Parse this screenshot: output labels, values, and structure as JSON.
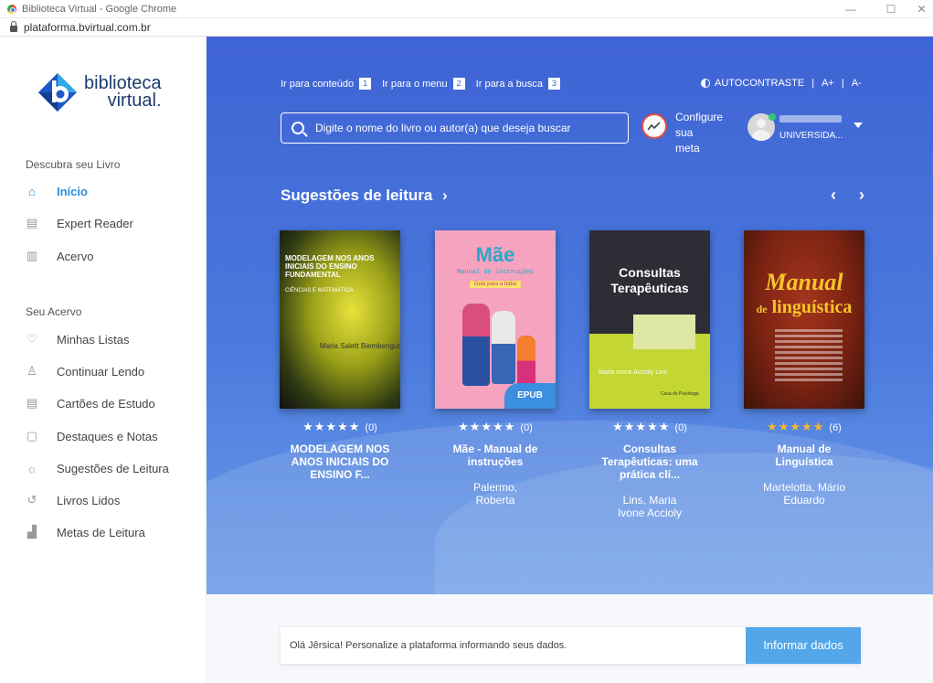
{
  "browser": {
    "window_title": "Biblioteca Virtual - Google Chrome",
    "url": "plataforma.bvirtual.com.br",
    "minimize": "—",
    "maximize": "☐",
    "close": "✕"
  },
  "brand": {
    "line1": "biblioteca",
    "line2": "virtual."
  },
  "sidebar": {
    "section1": "Descubra seu Livro",
    "nav1": [
      {
        "label": "Início",
        "icon": "home-icon",
        "glyph": "⌂"
      },
      {
        "label": "Expert Reader",
        "icon": "document-list-icon",
        "glyph": "▤"
      },
      {
        "label": "Acervo",
        "icon": "bookshelf-icon",
        "glyph": "▥"
      }
    ],
    "section2": "Seu Acervo",
    "nav2": [
      {
        "label": "Minhas Listas",
        "icon": "heart-icon",
        "glyph": "♡"
      },
      {
        "label": "Continuar Lendo",
        "icon": "reading-person-icon",
        "glyph": "♙"
      },
      {
        "label": "Cartões de Estudo",
        "icon": "flashcard-icon",
        "glyph": "▤"
      },
      {
        "label": "Destaques e Notas",
        "icon": "note-icon",
        "glyph": "▢"
      },
      {
        "label": "Sugestões de Leitura",
        "icon": "lightbulb-icon",
        "glyph": "☼"
      },
      {
        "label": "Livros Lidos",
        "icon": "history-icon",
        "glyph": "↺"
      },
      {
        "label": "Metas de Leitura",
        "icon": "chart-icon",
        "glyph": "▟"
      }
    ]
  },
  "topnav": {
    "skip_content": "Ir para conteúdo",
    "num1": "1",
    "skip_menu": "Ir para o menu",
    "num2": "2",
    "skip_search": "Ir para a busca",
    "num3": "3",
    "contrast": "AUTOCONTRASTE",
    "sep": "|",
    "font_up": "A+",
    "font_down": "A-"
  },
  "search": {
    "placeholder": "Digite o nome do livro ou autor(a) que deseja buscar"
  },
  "goal": {
    "line1": "Configure sua",
    "line2": "meta"
  },
  "user": {
    "org": "UNIVERSIDA..."
  },
  "suggestions": {
    "title": "Sugestões de leitura",
    "title_arrow": "›",
    "prev": "‹",
    "next": "›"
  },
  "books": [
    {
      "cover_title": "MODELAGEM NOS ANOS INICIAIS DO ENSINO FUNDAMENTAL",
      "cover_sub": "CIÊNCIAS E MATEMÁTICA",
      "cover_author": "Maria Salett Biembengut",
      "stars": "★★★★★",
      "count": "(0)",
      "title": "MODELAGEM NOS ANOS INICIAIS DO ENSINO F...",
      "author": ""
    },
    {
      "cover_title": "Mãe",
      "cover_sub": "Manual de instruções",
      "cover_tag": "Guia para a baba",
      "badge": "EPUB",
      "stars": "★★★★★",
      "count": "(0)",
      "title": "Mãe - Manual de instruções",
      "author": "Palermo, Roberta"
    },
    {
      "cover_title": "Consultas Terapêuticas",
      "cover_author": "Maria Ivone Accioly Lins",
      "cover_pub": "Casa do Psicólogo",
      "stars": "★★★★★",
      "count": "(0)",
      "title": "Consultas Terapêuticas: uma prática clí...",
      "author": "Lins, Maria Ivone Accioly"
    },
    {
      "cover_title": "Manual",
      "cover_sub_small": "de",
      "cover_sub": "linguística",
      "stars": "★★★★★",
      "count": "(6)",
      "title": "Manual de Linguística",
      "author": "Martelotta, Mário Eduardo"
    }
  ],
  "prompt": {
    "message": "Olá Jêrsica! Personalize a plataforma informando seus dados.",
    "button": "Informar dados"
  },
  "colors": {
    "accent": "#2a8fd8",
    "hero_top": "#3f63d4",
    "hero_bottom": "#6a9be6",
    "star_gold": "#f6b632",
    "button": "#53a6ea"
  }
}
